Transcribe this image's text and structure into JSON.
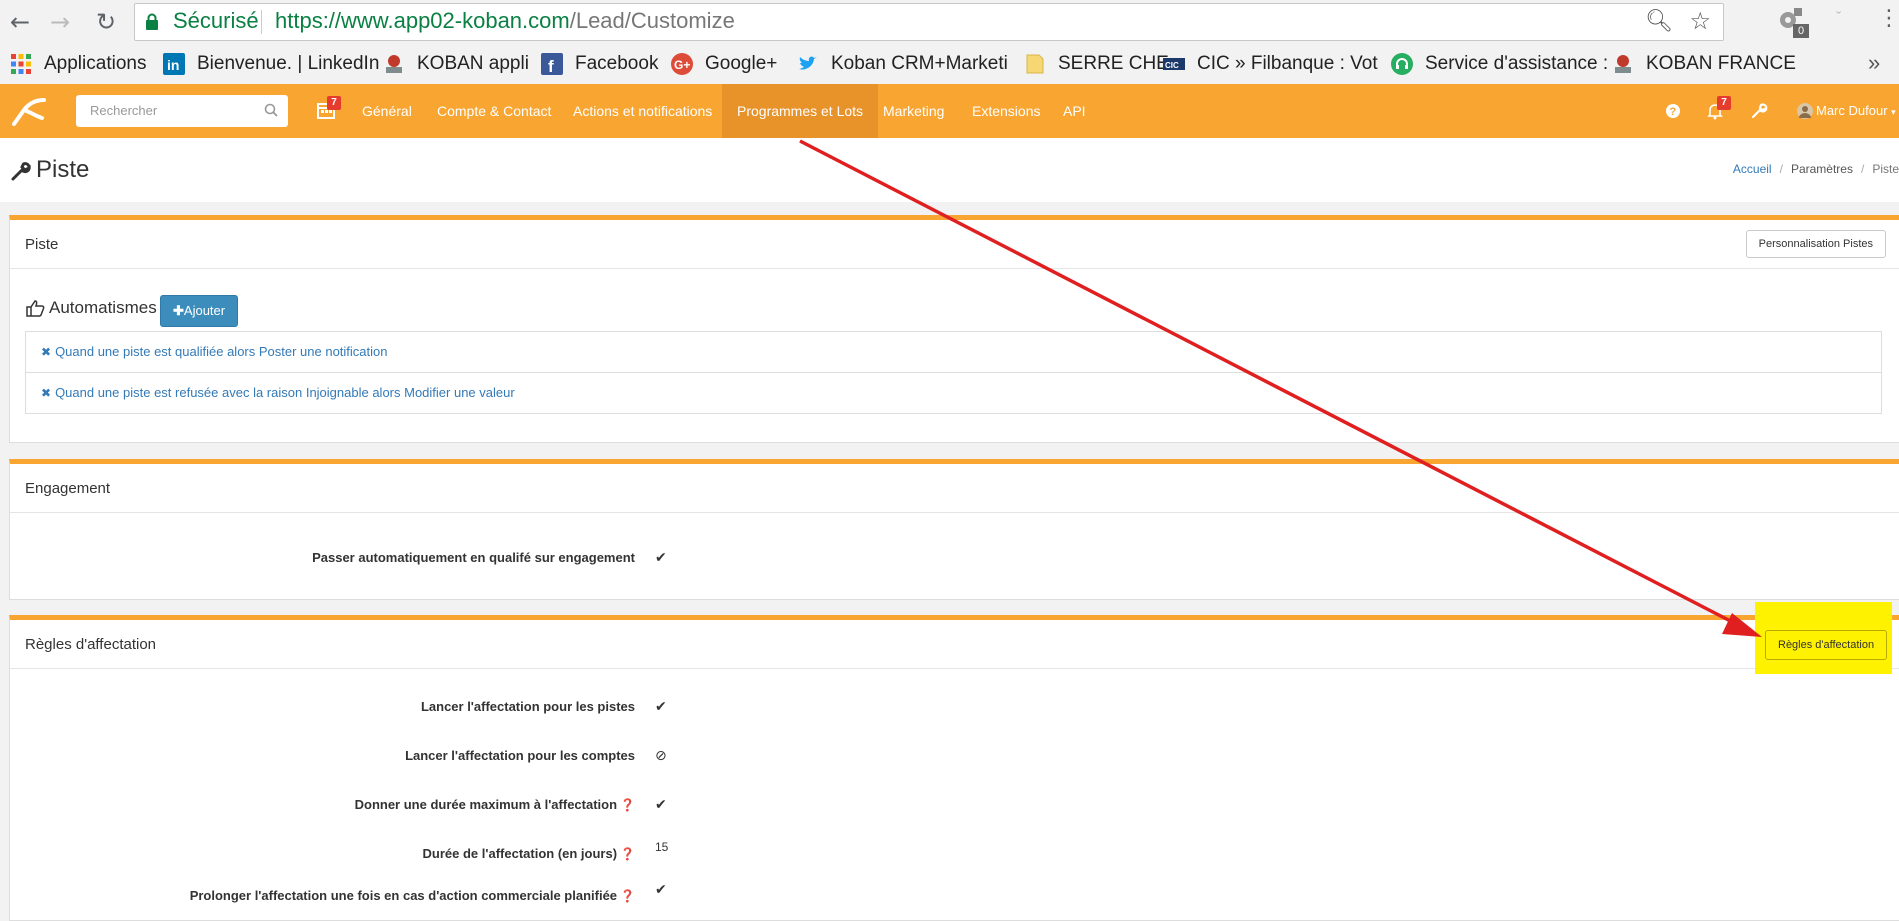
{
  "browser": {
    "secure_label": "Sécurisé",
    "url_host": "https://www.app02-koban.com",
    "url_path": "/Lead/Customize",
    "extension_badge": "0",
    "bookmarks": [
      {
        "label": "Applications",
        "icon": "apps-grid-icon"
      },
      {
        "label": "Bienvenue. | LinkedIn",
        "icon": "linkedin-icon"
      },
      {
        "label": "KOBAN appli",
        "icon": "koban-favicon-icon"
      },
      {
        "label": "Facebook",
        "icon": "facebook-icon"
      },
      {
        "label": "Google+",
        "icon": "google-plus-icon"
      },
      {
        "label": "Koban CRM+Marketi",
        "icon": "twitter-icon"
      },
      {
        "label": "SERRE CHE",
        "icon": "folder-icon"
      },
      {
        "label": "CIC » Filbanque : Vot",
        "icon": "cic-icon"
      },
      {
        "label": "Service d'assistance :",
        "icon": "support-headset-icon"
      },
      {
        "label": "KOBAN FRANCE",
        "icon": "koban-favicon-icon"
      }
    ],
    "bookmarks_more": "»"
  },
  "app": {
    "search_placeholder": "Rechercher",
    "calendar_badge": "7",
    "nav": [
      "Général",
      "Compte & Contact",
      "Actions et notifications",
      "Programmes et Lots",
      "Marketing",
      "Extensions",
      "API"
    ],
    "active_nav": "Programmes et Lots",
    "notif_badge": "7",
    "user_name": "Marc Dufour",
    "accent_color": "#f8a531"
  },
  "page": {
    "title": "Piste",
    "breadcrumb": [
      "Accueil",
      "Paramètres",
      "Piste"
    ]
  },
  "panel_piste": {
    "title": "Piste",
    "button": "Personnalisation Pistes",
    "automations_title": "Automatismes",
    "add_button": "Ajouter",
    "rules": [
      "Quand une piste est qualifiée alors Poster une notification",
      "Quand une piste est refusée avec la raison Injoignable alors Modifier une valeur"
    ]
  },
  "panel_engagement": {
    "title": "Engagement",
    "rows": [
      {
        "label": "Passer automatiquement en qualifé sur engagement",
        "value": "✔"
      }
    ]
  },
  "panel_regles": {
    "title": "Règles d'affectation",
    "button": "Règles d'affectation",
    "rows": [
      {
        "label": "Lancer l'affectation pour les pistes",
        "value": "✔"
      },
      {
        "label": "Lancer l'affectation pour les comptes",
        "value": "⊘"
      },
      {
        "label": "Donner une durée maximum à l'affectation",
        "value": "✔"
      },
      {
        "label": "Durée de l'affectation (en jours)",
        "value": "15"
      },
      {
        "label": "Prolonger l'affectation une fois en cas d'action commerciale planifiée",
        "value": "✔"
      }
    ]
  },
  "annotation": {
    "arrow_color": "#e02020",
    "highlight_color": "#fff200"
  }
}
